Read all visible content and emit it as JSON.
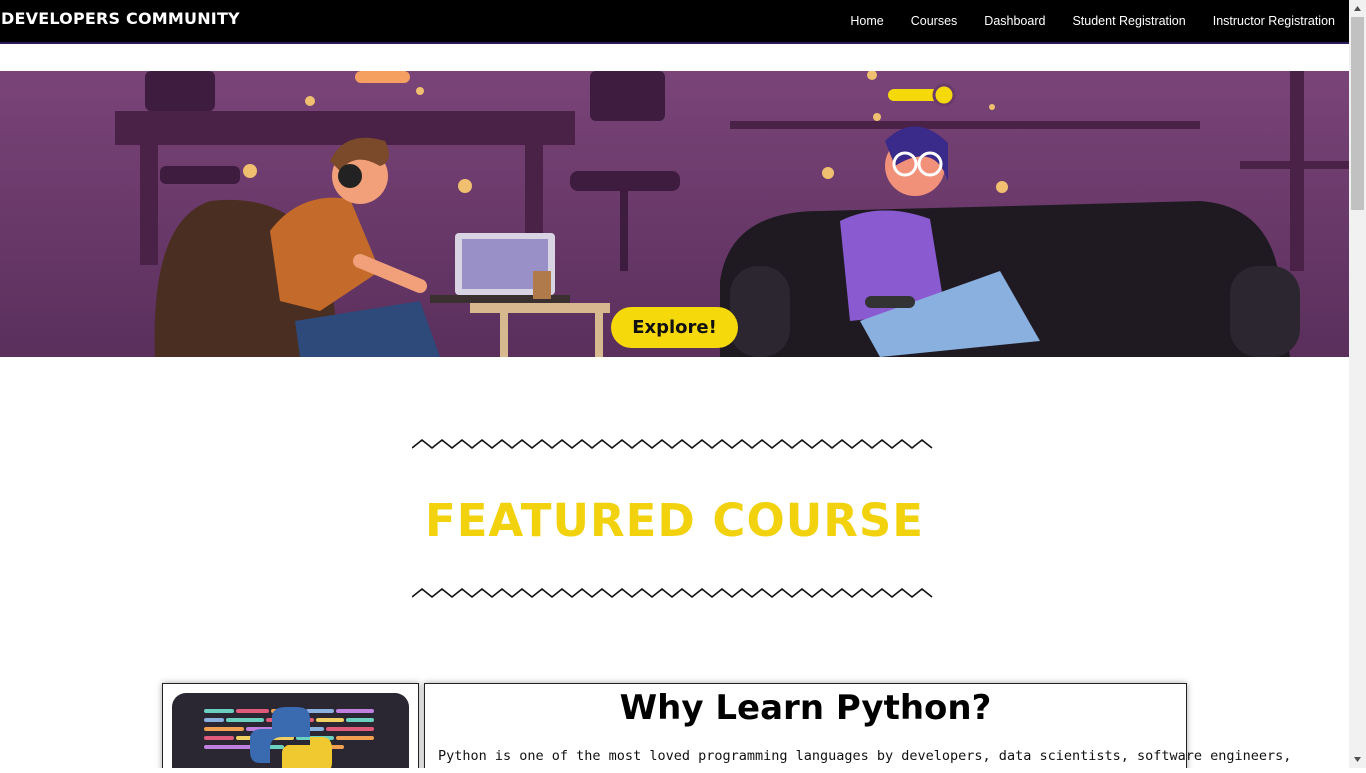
{
  "nav": {
    "brand": "DEVELOPERS COMMUNITY",
    "links": [
      "Home",
      "Courses",
      "Dashboard",
      "Student Registration",
      "Instructor Registration"
    ]
  },
  "hero": {
    "cta_label": "Explore!"
  },
  "featured": {
    "title": "FEATURED COURSE"
  },
  "course_card": {
    "title": "Why Learn Python?",
    "body": "Python is one of the most loved programming languages by developers, data scientists, software engineers,"
  },
  "colors": {
    "accent_yellow": "#f2d20c",
    "nav_bg": "#000000",
    "hero_purple": "#6a3a6c"
  }
}
